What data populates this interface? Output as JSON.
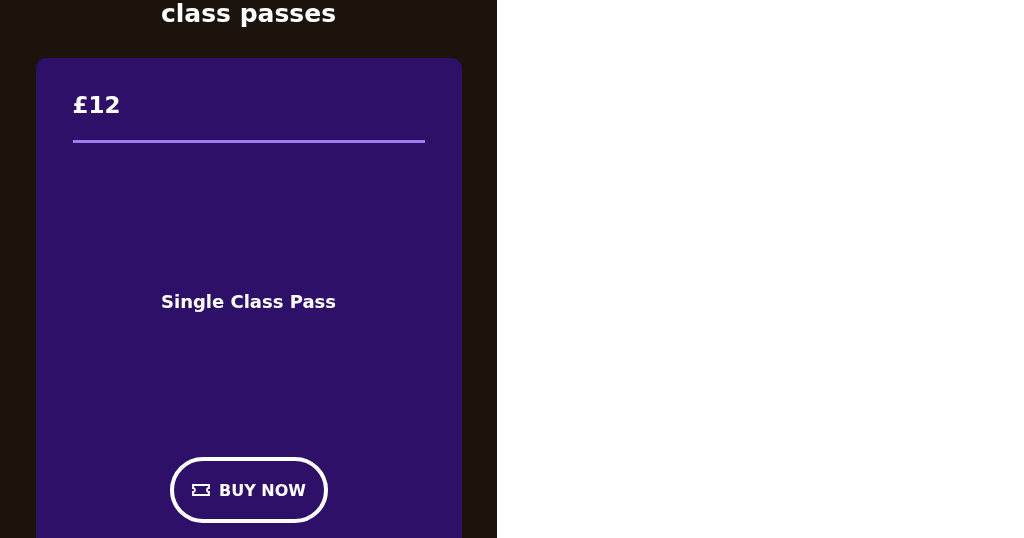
{
  "heading": "class passes",
  "pass_card": {
    "price": "£12",
    "name": "Single Class Pass",
    "button": {
      "label": "BUY NOW"
    }
  }
}
